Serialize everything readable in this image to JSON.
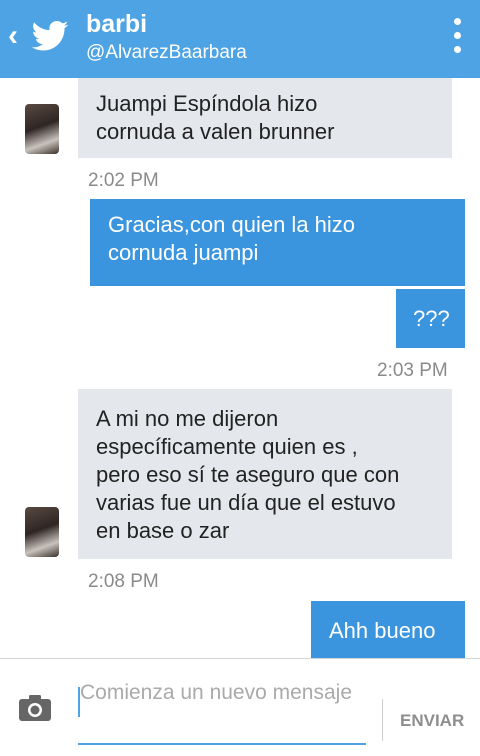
{
  "header": {
    "back_glyph": "‹",
    "name": "barbi",
    "handle": "@AlvarezBaarbara",
    "bg_color": "#4da3e3"
  },
  "messages": [
    {
      "direction": "in",
      "text": "Juampi Espíndola hizo\ncornuda a valen brunner"
    },
    {
      "time": "2:02 PM"
    },
    {
      "direction": "out",
      "text": "Gracias,con quien la hizo\ncornuda juampi"
    },
    {
      "direction": "out",
      "text": "???"
    },
    {
      "time": "2:03 PM"
    },
    {
      "direction": "in",
      "text": "A mi no me dijeron\nespecíficamente quien es ,\npero eso sí te aseguro que con\nvarias fue un día que el estuvo\nen base o zar"
    },
    {
      "time": "2:08 PM"
    },
    {
      "direction": "out",
      "text": "Ahh bueno"
    }
  ],
  "composer": {
    "placeholder": "Comienza un nuevo mensaje",
    "send_label": "ENVIAR"
  },
  "icons": {
    "back": "chevron-left-icon",
    "logo": "twitter-bird-icon",
    "menu": "overflow-menu-icon",
    "camera": "camera-icon"
  }
}
